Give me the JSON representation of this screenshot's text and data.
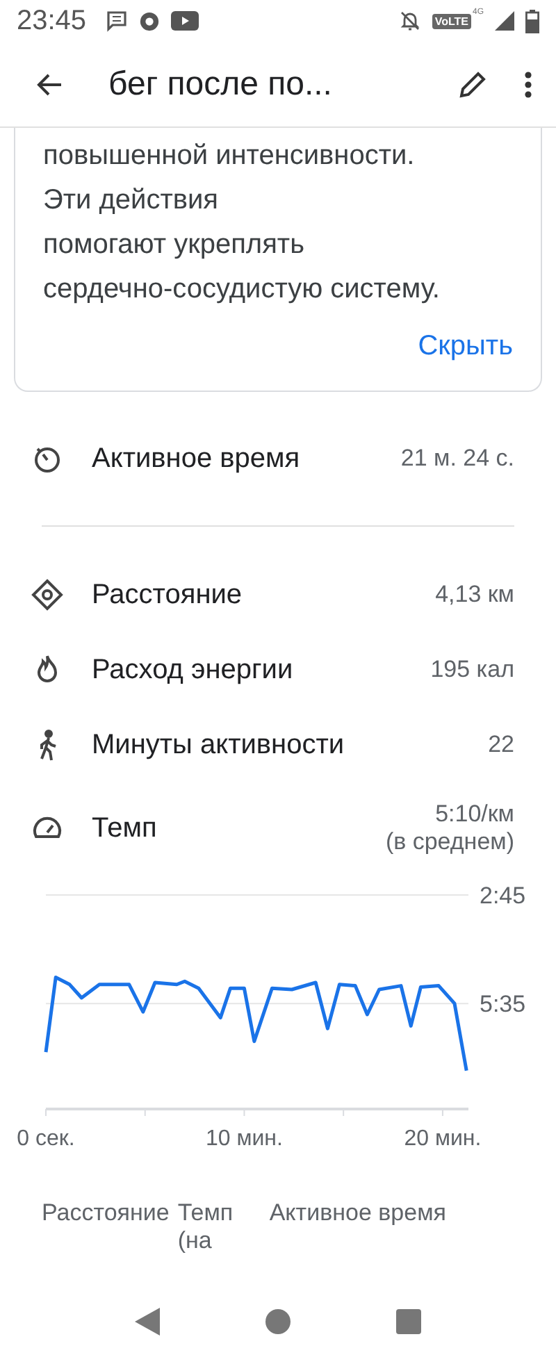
{
  "status_bar": {
    "time": "23:45",
    "network_label": "VoLTE",
    "network_type": "4G"
  },
  "app_bar": {
    "title": "бег после по..."
  },
  "info_card": {
    "lines": [
      "повышенной интенсивности.",
      "Эти действия",
      "помогают укреплять",
      "сердечно-сосудистую систему."
    ],
    "hide_link": "Скрыть"
  },
  "active_time": {
    "kind": "timer",
    "label": "Активное время",
    "value": "21 м. 24 с."
  },
  "metrics": [
    {
      "kind": "distance",
      "label": "Расстояние",
      "value": "4,13 км"
    },
    {
      "kind": "energy",
      "label": "Расход энергии",
      "value": "195 кал"
    },
    {
      "kind": "walk",
      "label": "Минуты активности",
      "value": "22"
    },
    {
      "kind": "pace",
      "label": "Темп",
      "value": "5:10/км",
      "note": "(в среднем)"
    }
  ],
  "pace_chart": {
    "chart_data": {
      "type": "line",
      "x": [
        0,
        0.5,
        1.2,
        1.8,
        2.7,
        4.2,
        4.9,
        5.5,
        6.6,
        7.0,
        7.7,
        8.8,
        9.3,
        10.0,
        10.5,
        11.4,
        12.4,
        13.6,
        14.2,
        14.8,
        15.6,
        16.2,
        16.8,
        17.9,
        18.4,
        18.9,
        19.8,
        20.6,
        21.2
      ],
      "series": [
        {
          "color": "#1a73e8",
          "values": [
            411,
            294,
            305,
            326,
            305,
            305,
            348,
            302,
            305,
            300,
            311,
            357,
            311,
            311,
            394,
            311,
            313,
            302,
            374,
            305,
            307,
            352,
            313,
            307,
            370,
            309,
            307,
            335,
            440
          ]
        }
      ],
      "xlim": [
        0,
        21.3
      ],
      "ylim": [
        500,
        165
      ],
      "xticks": [
        {
          "value": 0,
          "label": "0 сек."
        },
        {
          "value": 10,
          "label": "10 мин."
        },
        {
          "value": 20,
          "label": "20 мин."
        }
      ],
      "yticks": [
        {
          "value": 165,
          "label": "2:45"
        },
        {
          "value": 335,
          "label": "5:35"
        }
      ]
    }
  },
  "chart_tabs": [
    {
      "label": "Расстояние"
    },
    {
      "label": "Темп (на"
    },
    {
      "label": "Активное время"
    }
  ]
}
